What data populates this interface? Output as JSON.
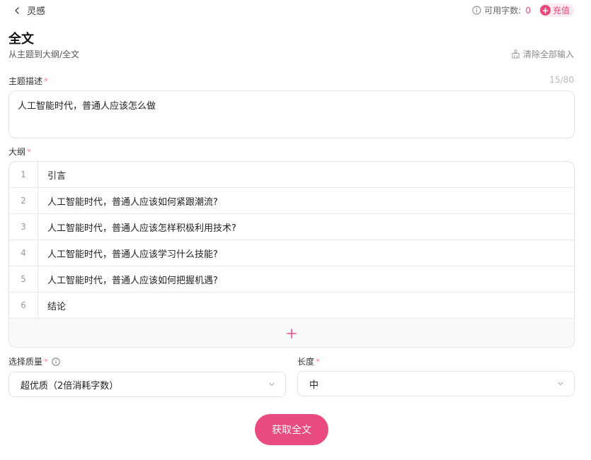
{
  "header": {
    "back_label": "灵感",
    "credits_label": "可用字数:",
    "credits_value": "0",
    "recharge_label": "充值"
  },
  "page": {
    "title": "全文",
    "subtitle": "从主题到大纲/全文",
    "clear_all_label": "清除全部输入"
  },
  "topic": {
    "label": "主题描述",
    "required_mark": "*",
    "counter": "15/80",
    "value": "人工智能时代，普通人应该怎么做"
  },
  "outline": {
    "label": "大纲",
    "required_mark": "*",
    "items": [
      {
        "num": "1",
        "text": "引言"
      },
      {
        "num": "2",
        "text": "人工智能时代，普通人应该如何紧跟潮流?"
      },
      {
        "num": "3",
        "text": "人工智能时代，普通人应该怎样积极利用技术?"
      },
      {
        "num": "4",
        "text": "人工智能时代，普通人应该学习什么技能?"
      },
      {
        "num": "5",
        "text": "人工智能时代，普通人应该如何把握机遇?"
      },
      {
        "num": "6",
        "text": "结论"
      }
    ]
  },
  "quality": {
    "label": "选择质量",
    "required_mark": "*",
    "selected": "超优质（2倍消耗字数）"
  },
  "length": {
    "label": "长度",
    "required_mark": "*",
    "selected": "中"
  },
  "submit_label": "获取全文",
  "colors": {
    "accent": "#ea4b7f",
    "accent_light": "#fde9f0"
  }
}
